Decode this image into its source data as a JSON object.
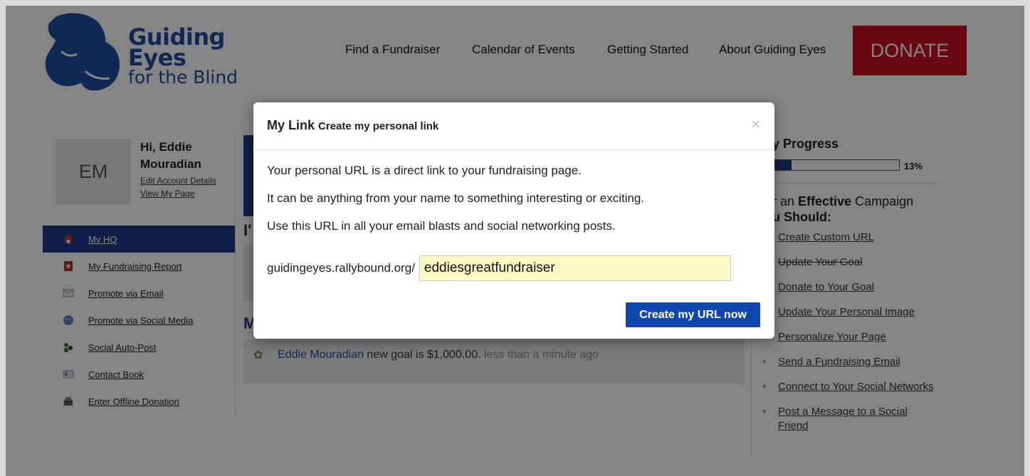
{
  "logo": {
    "line1": "Guiding",
    "line2": "Eyes",
    "line3": "for the Blind"
  },
  "nav": {
    "items": [
      "Find a Fundraiser",
      "Calendar of Events",
      "Getting Started",
      "About Guiding Eyes"
    ],
    "donate": "DONATE"
  },
  "colors": {
    "brand_blue": "#1f4fa1",
    "nav_blue": "#1e3c8c",
    "donate_red": "#c8101e",
    "button_blue": "#0f47ae",
    "input_yellow": "#fdfbc4"
  },
  "profile": {
    "initials": "EM",
    "greeting": "Hi, Eddie Mouradian",
    "edit_link": "Edit Account Details",
    "view_link": "View My Page"
  },
  "sidebar": {
    "items": [
      {
        "label": "My HQ",
        "icon": "home-icon"
      },
      {
        "label": "My Fundraising Report",
        "icon": "report-icon"
      },
      {
        "label": "Promote via Email",
        "icon": "email-icon"
      },
      {
        "label": "Promote via Social Media",
        "icon": "globe-icon"
      },
      {
        "label": "Social Auto-Post",
        "icon": "people-icon"
      },
      {
        "label": "Contact Book",
        "icon": "contact-card-icon"
      },
      {
        "label": "Enter Offline Donation",
        "icon": "register-icon"
      }
    ]
  },
  "center": {
    "partial_i": "I'",
    "partial_m": "M",
    "activity": {
      "name": "Eddie Mouradian",
      "text": " new goal is $1,000.00. ",
      "time": "less than a minute ago"
    }
  },
  "progress": {
    "title": "y Progress",
    "percent_label": "13%",
    "percent": 0.13,
    "heading_pre": "r an ",
    "heading_bold": "Effective",
    "heading_post": " Campaign",
    "heading_line2": "u Should:",
    "tasks": [
      {
        "label": "Create Custom URL",
        "done": false
      },
      {
        "label": "Update Your Goal",
        "done": true
      },
      {
        "label": "Donate to Your Goal",
        "done": false
      },
      {
        "label": "Update Your Personal Image",
        "done": false
      },
      {
        "label": "Personalize Your Page",
        "done": false
      },
      {
        "label": "Send a Fundraising Email",
        "done": false
      },
      {
        "label": "Connect to Your Social Networks",
        "done": false
      },
      {
        "label": "Post a Message to a Social Friend",
        "done": false
      }
    ]
  },
  "modal": {
    "title": "My Link",
    "subtitle": "Create my personal link",
    "close": "×",
    "lines": [
      "Your personal URL is a direct link to your fundraising page.",
      "It can be anything from your name to something interesting or exciting.",
      "Use this URL in all your email blasts and social networking posts."
    ],
    "url_prefix": "guidingeyes.rallybound.org/",
    "url_value": "eddiesgreatfundraiser",
    "button": "Create my URL now"
  }
}
